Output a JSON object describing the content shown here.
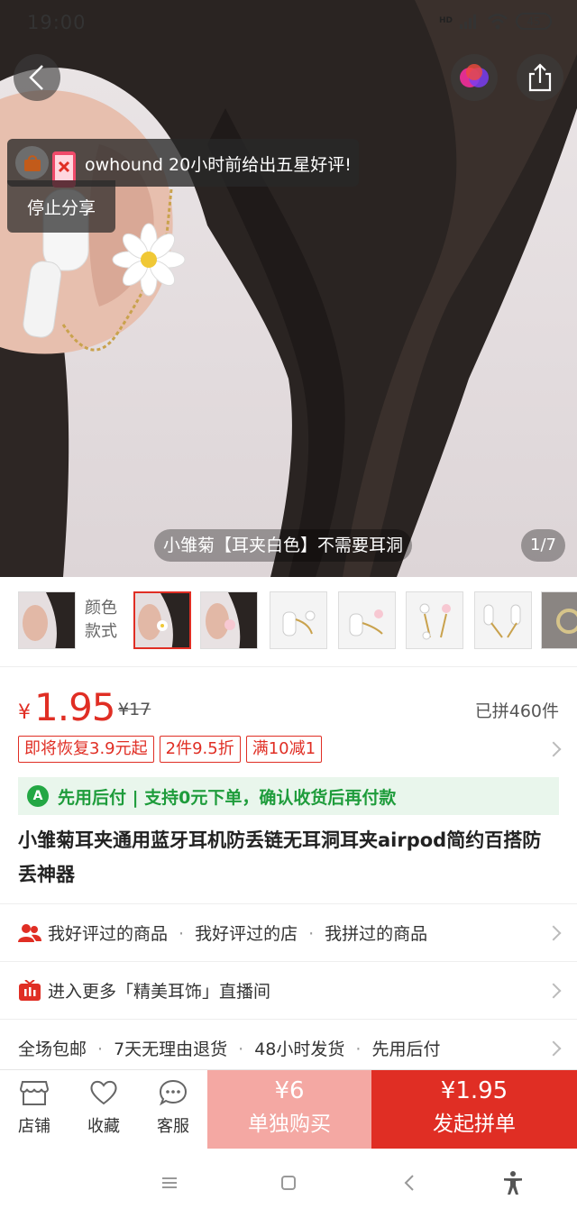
{
  "status_bar": {
    "time": "19:00",
    "network": "HD",
    "battery": "45"
  },
  "hero": {
    "toast_text": "owhound 20小时前给出五星好评!",
    "stop_share": "停止分享",
    "caption": "小雏菊【耳夹白色】不需要耳洞",
    "counter": "1/7"
  },
  "thumbs": {
    "label": "颜色款式"
  },
  "price": {
    "currency": "¥",
    "current": "1.95",
    "original": "¥17",
    "sold": "已拼460件"
  },
  "promos": [
    "即将恢复3.9元起",
    "2件9.5折",
    "满10减1"
  ],
  "paylater": {
    "icon_letter": "A",
    "text": "先用后付 | 支持0元下单，确认收货后再付款"
  },
  "product_title": "小雏菊耳夹通用蓝牙耳机防丢链无耳洞耳夹airpod简约百搭防丢神器",
  "history_row": {
    "items": [
      "我好评过的商品",
      "我好评过的店",
      "我拼过的商品"
    ]
  },
  "live_row": {
    "text": "进入更多「精美耳饰」直播间"
  },
  "service_row": {
    "items": [
      "全场包邮",
      "7天无理由退货",
      "48小时发货",
      "先用后付"
    ]
  },
  "bottom_bar": {
    "store": "店铺",
    "favorite": "收藏",
    "service": "客服",
    "single_price": "¥6",
    "single_label": "单独购买",
    "group_price": "¥1.95",
    "group_label": "发起拼单"
  },
  "colors": {
    "accent": "#e02e24",
    "single_btn": "#f4a8a3",
    "paylater_green": "#1e9c3b"
  }
}
